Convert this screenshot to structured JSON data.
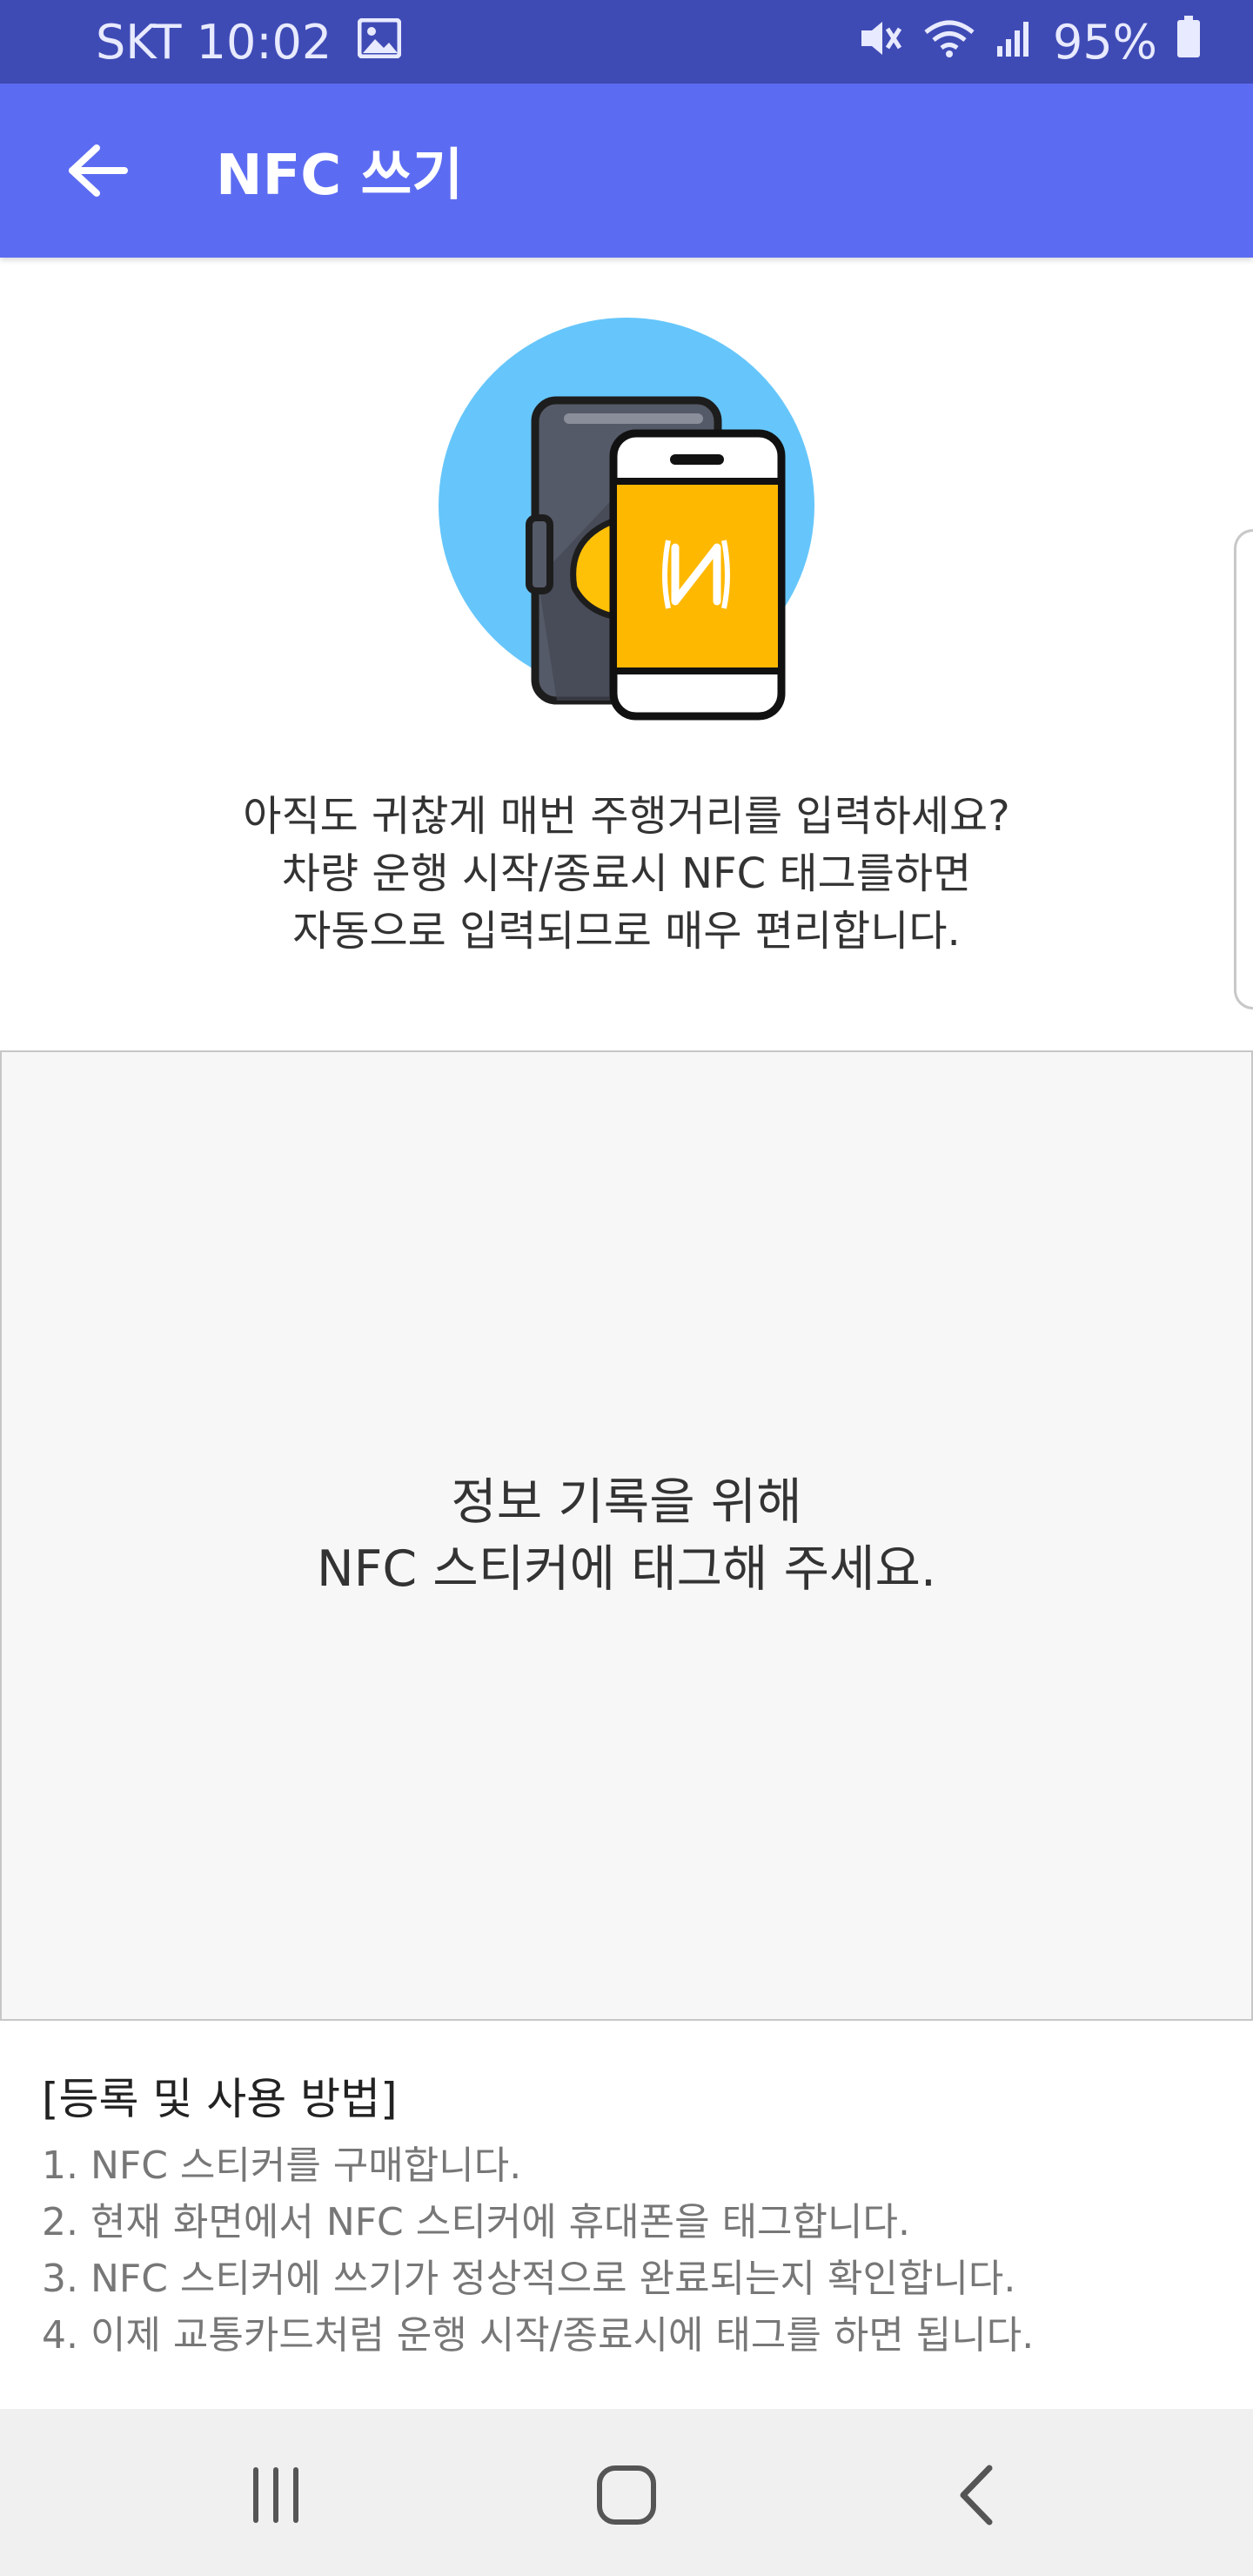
{
  "status_bar": {
    "carrier_time": "SKT 10:02",
    "battery_percent": "95%",
    "icons": [
      "gallery-icon",
      "vibrate-mute-icon",
      "wifi-icon",
      "signal-icon",
      "battery-icon"
    ]
  },
  "app_bar": {
    "title": "NFC 쓰기",
    "back_icon": "arrow-left-icon",
    "color": "#5c6cf2"
  },
  "intro": {
    "line1": "아직도 귀찮게 매번 주행거리를 입력하세요?",
    "line2": "차량 운행 시작/종료시 NFC 태그를하면",
    "line3": "자동으로 입력되므로 매우 편리합니다."
  },
  "tag_area": {
    "line1": "정보 기록을 위해",
    "line2": "NFC 스티커에 태그해 주세요."
  },
  "howto": {
    "title": "[등록 및 사용 방법]",
    "steps": [
      "1. NFC 스티커를 구매합니다.",
      "2. 현재 화면에서 NFC 스티커에 휴대폰을 태그합니다.",
      "3. NFC 스티커에 쓰기가 정상적으로 완료되는지 확인합니다.",
      "4. 이제 교통카드처럼 운행 시작/종료시에 태그를 하면 됩니다."
    ]
  },
  "nav_bar": {
    "buttons": [
      "recent-apps-icon",
      "home-icon",
      "back-icon"
    ]
  }
}
